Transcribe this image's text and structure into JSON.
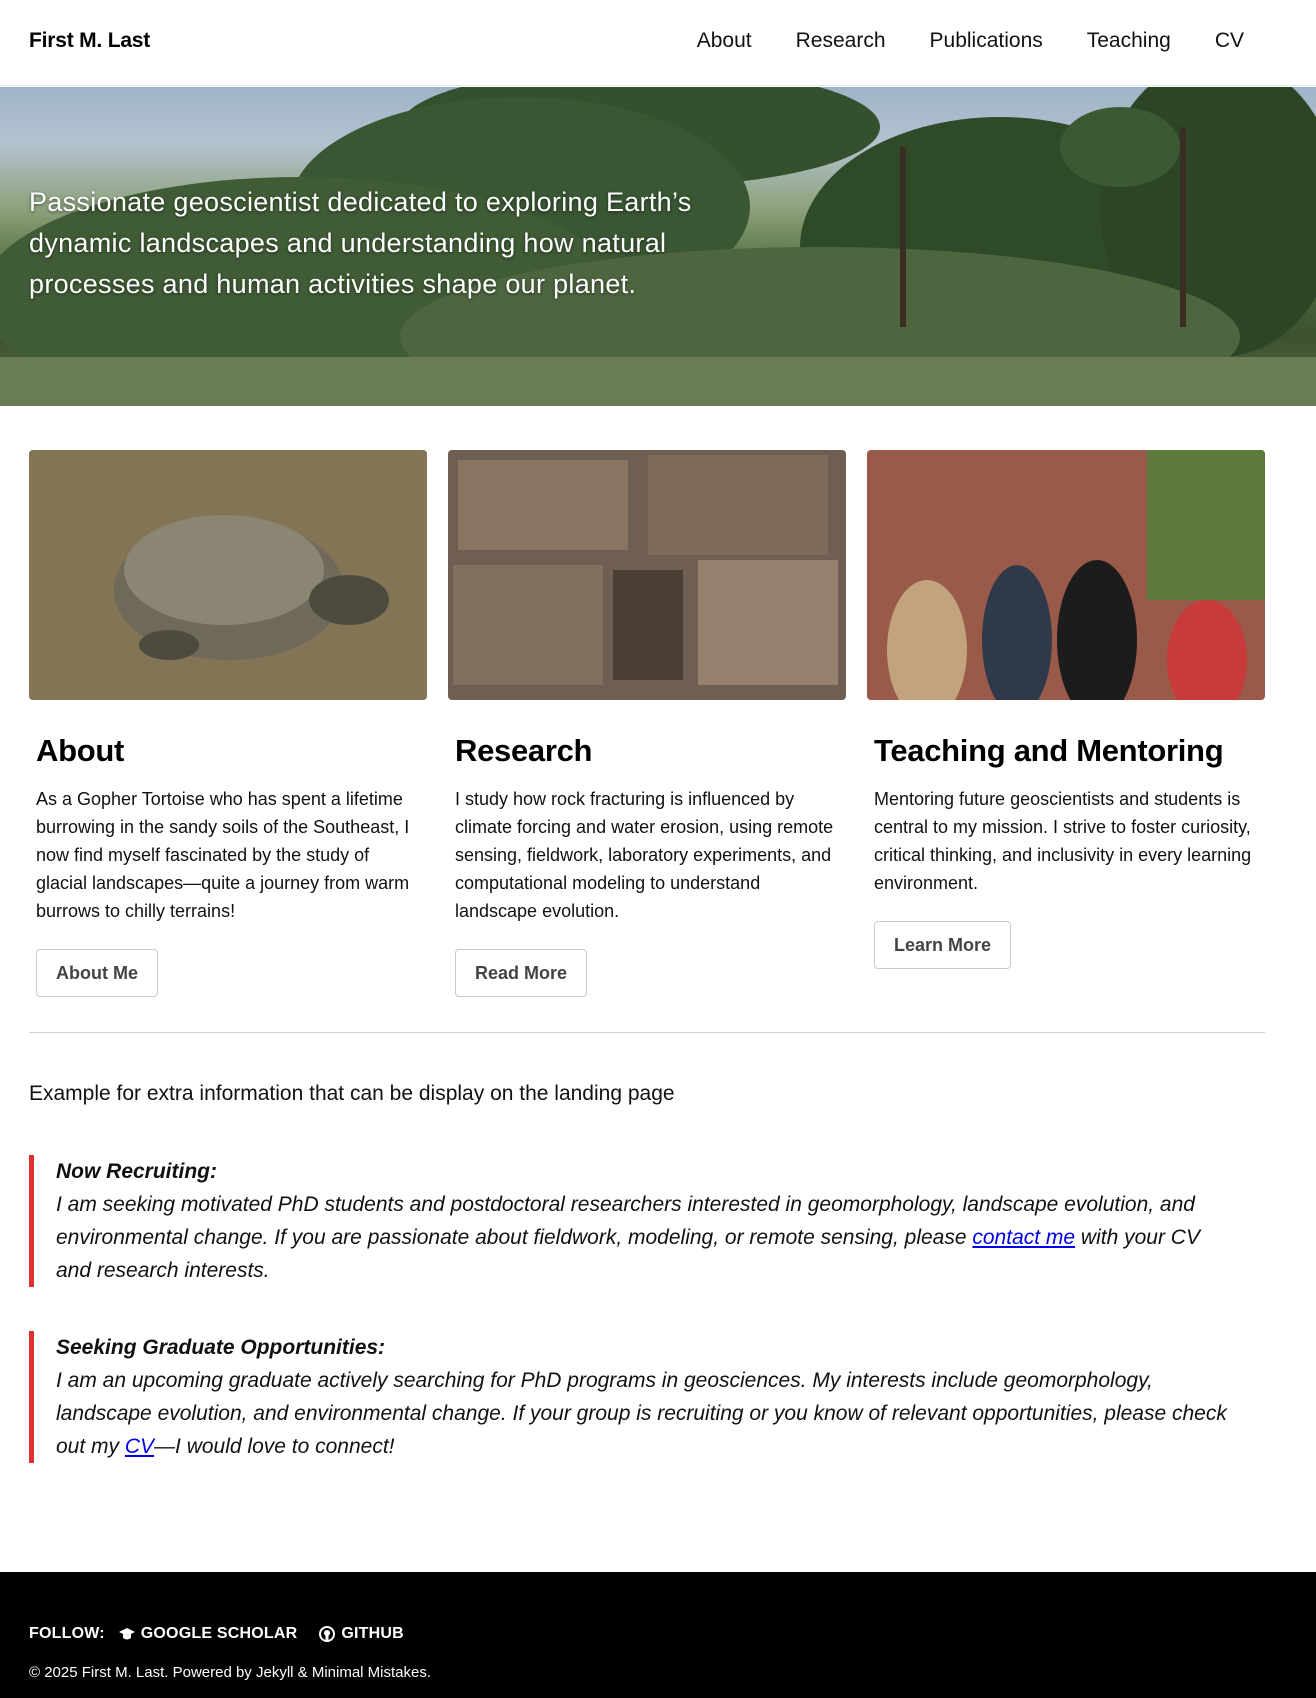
{
  "masthead": {
    "site_title": "First M. Last",
    "nav": [
      "About",
      "Research",
      "Publications",
      "Teaching",
      "CV"
    ]
  },
  "hero": {
    "tagline": "Passionate geoscientist dedicated to exploring Earth’s dynamic landscapes and understanding how natural processes and human activities shape our planet."
  },
  "cards": [
    {
      "title": "About",
      "text": "As a Gopher Tortoise who has spent a lifetime burrowing in the sandy soils of the Southeast, I now find myself fascinated by the study of glacial landscapes—quite a journey from warm burrows to chilly terrains!",
      "button": "About Me"
    },
    {
      "title": "Research",
      "text": "I study how rock fracturing is influenced by climate forcing and water erosion, using remote sensing, fieldwork, laboratory experiments, and computational modeling to understand landscape evolution.",
      "button": "Read More"
    },
    {
      "title": "Teaching and Mentoring",
      "text": "Mentoring future geoscientists and students is central to my mission. I strive to foster curiosity, critical thinking, and inclusivity in every learning environment.",
      "button": "Learn More"
    }
  ],
  "extra": {
    "intro": "Example for extra information that can be display on the landing page",
    "notice1": {
      "heading": "Now Recruiting:",
      "text_before": "I am seeking motivated PhD students and postdoctoral researchers interested in geomorphology, landscape evolution, and environmental change. If you are passionate about fieldwork, modeling, or remote sensing, please ",
      "link": "contact me",
      "text_after": " with your CV and research interests."
    },
    "notice2": {
      "heading": "Seeking Graduate Opportunities:",
      "text_before": "I am an upcoming graduate actively searching for PhD programs in geosciences. My interests include geomorphology, landscape evolution, and environmental change. If your group is recruiting or you know of relevant opportunities, please check out my ",
      "link": "CV",
      "text_after": "—I would love to connect!"
    }
  },
  "footer": {
    "follow_label": "FOLLOW:",
    "links": [
      "GOOGLE SCHOLAR",
      "GITHUB"
    ],
    "icons": [
      "graduation-cap-icon",
      "github-icon"
    ],
    "copyright": "© 2025 First M. Last. Powered by Jekyll & Minimal Mistakes."
  },
  "colors": {
    "notice_border": "#e03131",
    "link": "#0000ee",
    "footer_bg": "#000000"
  }
}
